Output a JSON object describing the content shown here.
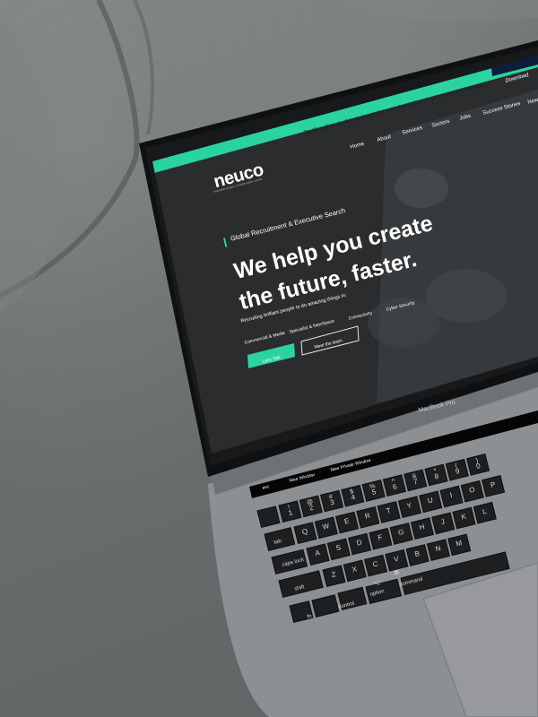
{
  "site": {
    "announcement": "Tackling diversity & inclusion in the workplace | Download our latest whitepaper",
    "download_label": "Download",
    "logo_text": "neuco",
    "logo_tagline": "Innovative people | Transformative results",
    "nav": [
      "Home",
      "About",
      "Services",
      "Sectors",
      "Jobs",
      "Success Stories",
      "News"
    ],
    "hero": {
      "kicker": "Global Recruitment & Executive Search",
      "headline_line1": "We help you create",
      "headline_line2": "the future, faster.",
      "subtext": "Recruiting brilliant people to do amazing things in:",
      "tags": [
        "Commercial & Media",
        "Specialist & NewSpace",
        "Connectivity",
        "Cyber Security"
      ],
      "cta_primary": "Let's Talk",
      "cta_secondary": "Meet the team"
    }
  },
  "device": {
    "model_label": "MacBook Pro",
    "touchbar": [
      "esc",
      "New Window",
      "New Private Window"
    ]
  },
  "keyboard": {
    "row_numbers": [
      "!",
      "@",
      "#",
      "$",
      "%",
      "^",
      "&",
      "*",
      "(",
      ")"
    ],
    "row_numbers_sub": [
      "1",
      "2",
      "3",
      "4",
      "5",
      "6",
      "7",
      "8",
      "9",
      "0"
    ],
    "row_q": [
      "Q",
      "W",
      "E",
      "R",
      "T",
      "Y",
      "U",
      "I",
      "O",
      "P"
    ],
    "row_a": [
      "A",
      "S",
      "D",
      "F",
      "G",
      "H",
      "J",
      "K",
      "L"
    ],
    "row_z": [
      "Z",
      "X",
      "C",
      "V",
      "B",
      "N",
      "M"
    ],
    "mod_tab": "tab",
    "mod_caps": "caps lock",
    "mod_shift": "shift",
    "mod_fn": "fn",
    "mod_control": "control",
    "mod_option": "option",
    "mod_command": "command",
    "mod_command_symbol": "⌘",
    "mod_option_symbol": "⌥"
  },
  "colors": {
    "accent": "#2bd3a0",
    "screen_bg": "#2a2c2d",
    "couch": "#6d7272",
    "laptop_body": "#8a8d90"
  }
}
